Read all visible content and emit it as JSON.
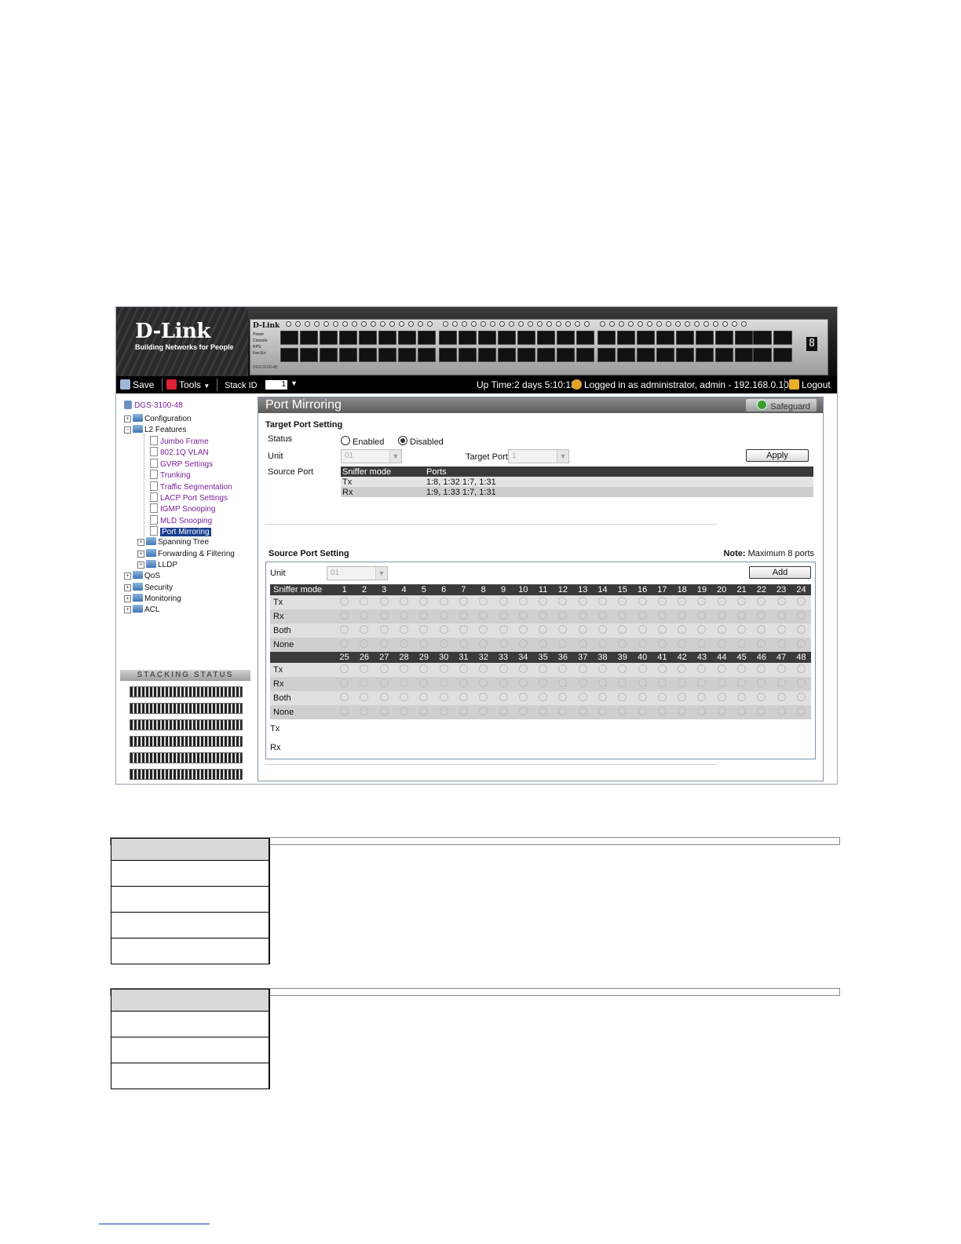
{
  "header": {
    "logo": "D-Link",
    "tagline": "Building Networks for People",
    "panel_brand": "D-Link",
    "panel_model": "DGS-3100-48",
    "panel_legend": [
      "Power",
      "Console",
      "RPS",
      "Fan Err"
    ],
    "digit": "8"
  },
  "toolbar": {
    "save_label": "Save",
    "tools_label": "Tools",
    "stack_id_label": "Stack ID",
    "stack_id_value": "1",
    "uptime": "Up Time:2 days 5:10:13",
    "login_info": "Logged in as administrator, admin - 192.168.0.100",
    "logout_label": "Logout"
  },
  "tree": {
    "root": "DGS-3100-48",
    "configuration": "Configuration",
    "l2_features": "L2 Features",
    "l2_items": [
      "Jumbo Frame",
      "802.1Q VLAN",
      "GVRP Settings",
      "Trunking",
      "Traffic Segmentation",
      "LACP Port Settings",
      "IGMP Snooping",
      "MLD Snooping",
      "Port Mirroring"
    ],
    "l2_folders": [
      "Spanning Tree",
      "Forwarding & Filtering",
      "LLDP"
    ],
    "top_folders": [
      "QoS",
      "Security",
      "Monitoring",
      "ACL"
    ]
  },
  "stacking_status": {
    "title": "STACKING STATUS",
    "units": 6
  },
  "main": {
    "title": "Port Mirroring",
    "safeguard": "Safeguard",
    "target_port_setting": {
      "heading": "Target Port Setting",
      "status_label": "Status",
      "enabled_label": "Enabled",
      "disabled_label": "Disabled",
      "selected": "Disabled",
      "unit_label": "Unit",
      "unit_value": "01",
      "target_port_label": "Target Port",
      "target_port_value": "1",
      "apply_label": "Apply",
      "source_port_label": "Source Port",
      "table_headers": [
        "Sniffer mode",
        "Ports"
      ],
      "table_rows": [
        {
          "mode": "Tx",
          "ports": "1:8, 1:32 1:7, 1:31"
        },
        {
          "mode": "Rx",
          "ports": "1:9, 1:33 1:7, 1:31"
        }
      ]
    },
    "source_port_setting": {
      "heading": "Source Port Setting",
      "note_label": "Note:",
      "note_text": "Maximum 8 ports",
      "unit_label": "Unit",
      "unit_value": "01",
      "add_label": "Add",
      "sniffer_mode_label": "Sniffer mode",
      "ports_row1": [
        "1",
        "2",
        "3",
        "4",
        "5",
        "6",
        "7",
        "8",
        "9",
        "10",
        "11",
        "12",
        "13",
        "14",
        "15",
        "16",
        "17",
        "18",
        "19",
        "20",
        "21",
        "22",
        "23",
        "24"
      ],
      "ports_row2": [
        "25",
        "26",
        "27",
        "28",
        "29",
        "30",
        "31",
        "32",
        "33",
        "34",
        "35",
        "36",
        "37",
        "38",
        "39",
        "40",
        "41",
        "42",
        "43",
        "44",
        "45",
        "46",
        "47",
        "48"
      ],
      "modes": [
        "Tx",
        "Rx",
        "Both",
        "None"
      ],
      "tx_label": "Tx",
      "rx_label": "Rx"
    }
  }
}
